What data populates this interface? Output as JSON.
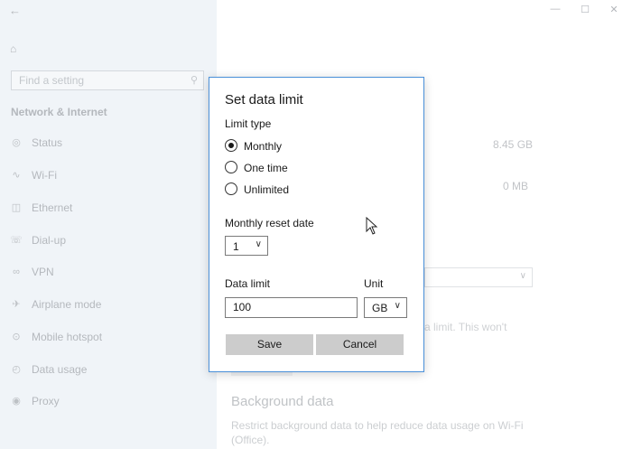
{
  "sidebar": {
    "search_placeholder": "Find a setting",
    "section_title": "Network & Internet",
    "items": [
      {
        "label": "Status",
        "icon": "globe-status-icon"
      },
      {
        "label": "Wi-Fi",
        "icon": "wifi-icon"
      },
      {
        "label": "Ethernet",
        "icon": "ethernet-icon"
      },
      {
        "label": "Dial-up",
        "icon": "phone-icon"
      },
      {
        "label": "VPN",
        "icon": "vpn-icon"
      },
      {
        "label": "Airplane mode",
        "icon": "airplane-icon"
      },
      {
        "label": "Mobile hotspot",
        "icon": "hotspot-icon"
      },
      {
        "label": "Data usage",
        "icon": "data-usage-icon"
      },
      {
        "label": "Proxy",
        "icon": "globe-icon"
      }
    ]
  },
  "main": {
    "usage_values": [
      "8.45 GB",
      "0 MB"
    ],
    "limit_note": "a limit. This won't",
    "background_data_title": "Background data",
    "background_data_desc": "Restrict background data to help reduce data usage on Wi-Fi (Office)."
  },
  "dialog": {
    "title": "Set data limit",
    "limit_type_label": "Limit type",
    "options": [
      {
        "label": "Monthly",
        "checked": true
      },
      {
        "label": "One time",
        "checked": false
      },
      {
        "label": "Unlimited",
        "checked": false
      }
    ],
    "reset_date_label": "Monthly reset date",
    "reset_date_value": "1",
    "data_limit_label": "Data limit",
    "data_limit_value": "100",
    "unit_label": "Unit",
    "unit_value": "GB",
    "save_label": "Save",
    "cancel_label": "Cancel"
  }
}
